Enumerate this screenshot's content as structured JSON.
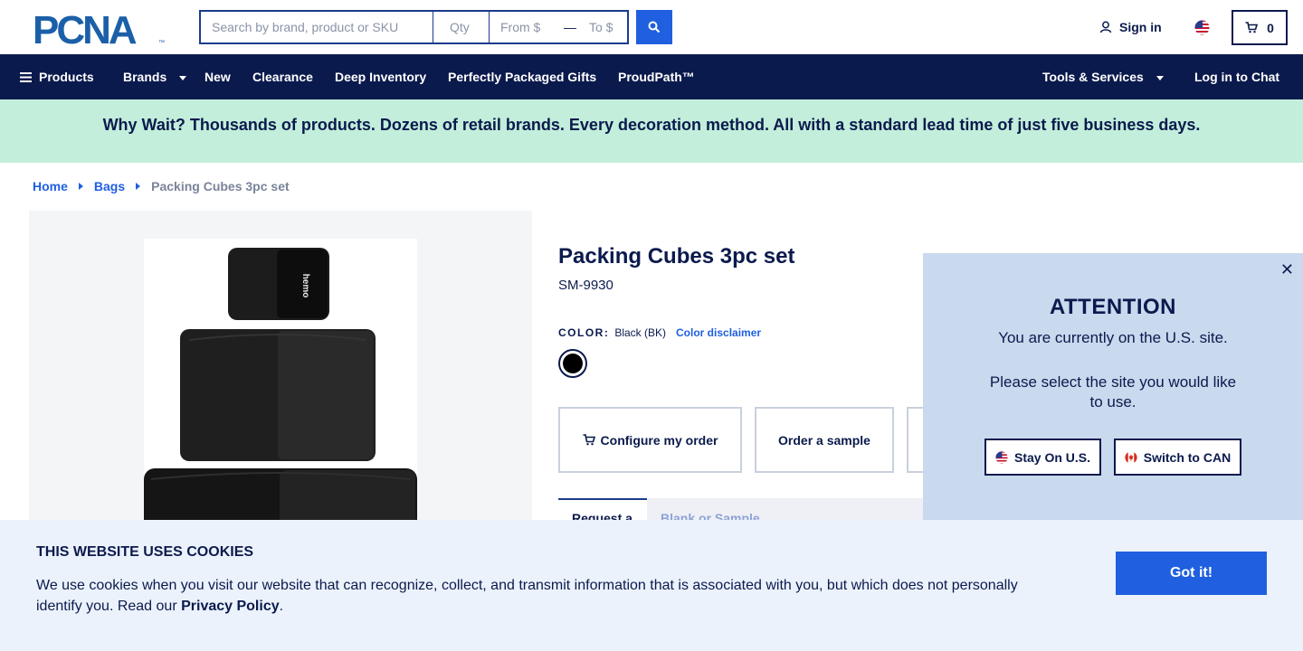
{
  "header": {
    "logo_text": "PCNA",
    "logo_mark": "™",
    "search": {
      "placeholder": "Search by brand, product or SKU",
      "qty_placeholder": "Qty",
      "from_placeholder": "From $",
      "range_dash": "—",
      "to_placeholder": "To $",
      "button_icon": "search-icon"
    },
    "signin_label": "Sign in",
    "cart_count": "0"
  },
  "nav": {
    "products": "Products",
    "brands": "Brands",
    "new": "New",
    "clearance": "Clearance",
    "deep_inventory": "Deep Inventory",
    "gifts": "Perfectly Packaged Gifts",
    "proudpath": "ProudPath™",
    "tools": "Tools & Services",
    "chat": "Log in to Chat"
  },
  "banner": {
    "text": "Why Wait? Thousands of products. Dozens of retail brands. Every decoration method. All with a standard lead time of just five business days."
  },
  "breadcrumb": {
    "home": "Home",
    "bags": "Bags",
    "current": "Packing Cubes 3pc set"
  },
  "product": {
    "title": "Packing Cubes 3pc set",
    "sku": "SM-9930",
    "image_brand_text": "hemo",
    "color_label": "COLOR:",
    "color_value": "Black (BK)",
    "color_disclaimer": "Color disclaimer",
    "swatch_color": "#000000",
    "actions": {
      "configure": "Configure my order",
      "sample": "Order a sample"
    },
    "tabs": {
      "active": "Request a",
      "other": "Blank or Sample"
    }
  },
  "region_modal": {
    "title": "ATTENTION",
    "message1": "You are currently on the U.S. site.",
    "message2": "Please select the site you would like to use.",
    "stay_label": "Stay On U.S.",
    "switch_label": "Switch to CAN"
  },
  "cookie": {
    "title": "THIS WEBSITE USES COOKIES",
    "text": "We use cookies when you visit our website that can recognize, collect, and transmit information that is associated with you, but which does not personally identify you. Read our ",
    "link": "Privacy Policy",
    "end": ".",
    "button": "Got it!"
  },
  "colors": {
    "navy": "#0b1a4d",
    "accent_blue": "#1f5fe0",
    "banner_green": "#c3eedb",
    "modal_bg": "#c9d9ee",
    "cookie_bg": "#ebf2fb"
  }
}
